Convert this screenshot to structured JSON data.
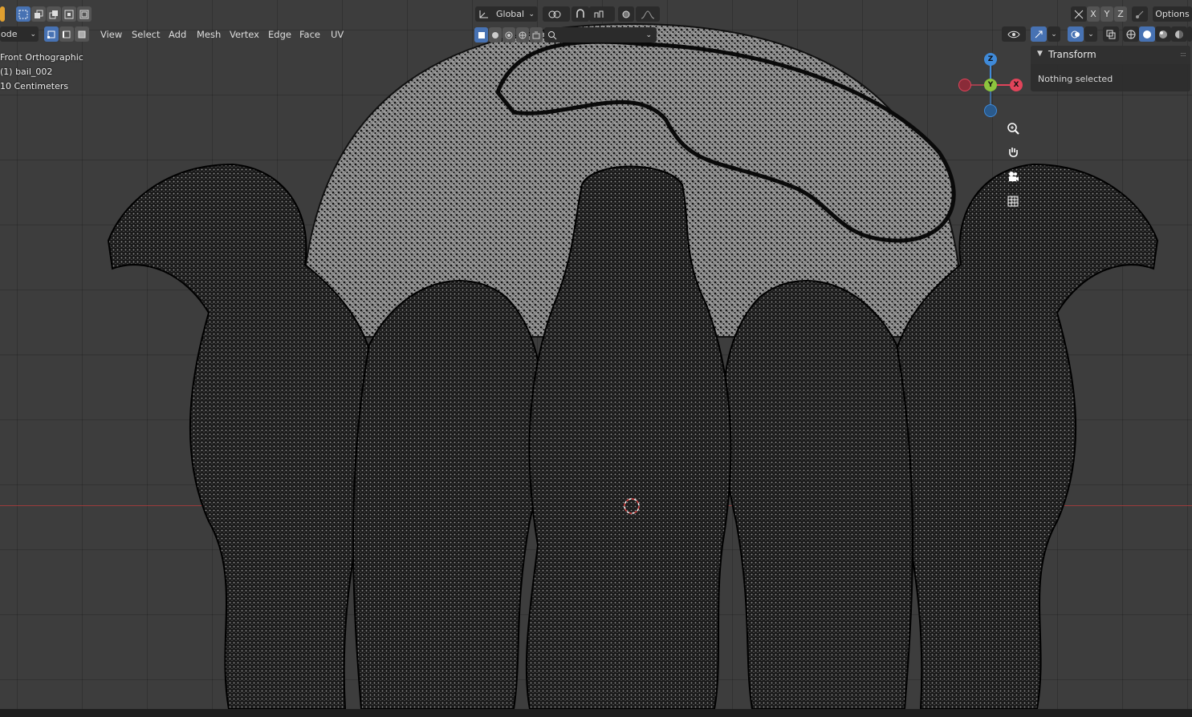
{
  "header": {
    "mode_label": "ode",
    "menus": [
      "View",
      "Select",
      "Add",
      "Mesh",
      "Vertex",
      "Edge",
      "Face",
      "UV"
    ],
    "transform_orientation": "Global",
    "axis_buttons": [
      "X",
      "Y",
      "Z"
    ],
    "options_label": "Options"
  },
  "viewport_info": {
    "view_name": "Front Orthographic",
    "object_name": "(1) bail_002",
    "scale": "10 Centimeters"
  },
  "sidebar_panel": {
    "title": "Transform",
    "body": "Nothing selected"
  },
  "gizmo": {
    "z_label": "Z",
    "y_label": "Y",
    "x_label": "X"
  },
  "colors": {
    "viewport_bg": "#3d3d3d",
    "x_axis": "#e0445a",
    "y_axis": "#8cc43d",
    "z_axis": "#3f8ad9",
    "active_blue": "#4772b3"
  },
  "icons": [
    "select-box-icon",
    "snap-icon",
    "proportional-edit-icon",
    "zoom-icon",
    "hand-icon",
    "camera-icon",
    "grid-icon",
    "overlay-icon",
    "shading-solid-icon"
  ]
}
